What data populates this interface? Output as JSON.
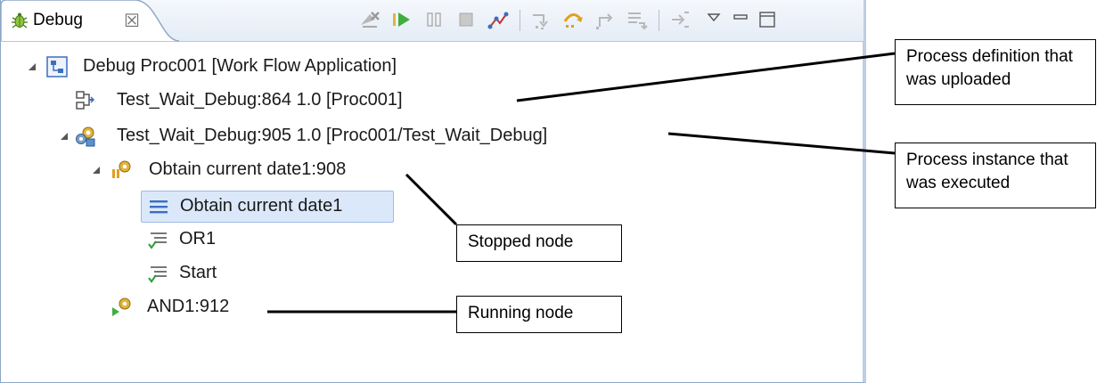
{
  "panel": {
    "tab_label": "Debug",
    "tab_close": "☒",
    "toolbar": [
      "remove-terminated-icon",
      "resume-icon",
      "suspend-icon",
      "terminate-icon",
      "disconnect-icon",
      "step-into-icon",
      "step-over-icon",
      "step-return-icon",
      "drop-to-frame-icon",
      "use-step-filters-icon",
      "view-menu-icon",
      "minimize-icon",
      "maximize-icon"
    ]
  },
  "tree": {
    "root": "Debug Proc001 [Work Flow Application]",
    "definition": "Test_Wait_Debug:864 1.0 [Proc001]",
    "instance": "Test_Wait_Debug:905 1.0 [Proc001/Test_Wait_Debug]",
    "thread_obtain": "Obtain current date1:908",
    "frame_obtain": "Obtain current date1",
    "frame_or": "OR1",
    "frame_start": "Start",
    "thread_and": "AND1:912"
  },
  "callouts": {
    "definition": "Process definition that was uploaded",
    "instance": "Process instance that was executed",
    "stopped": "Stopped node",
    "running": "Running node"
  },
  "colors": {
    "tab_border": "#8fa8c8",
    "selection": "#dbe8fa",
    "resume": "#3fae3f",
    "terminate": "#c0392b",
    "step": "#e0a020"
  }
}
